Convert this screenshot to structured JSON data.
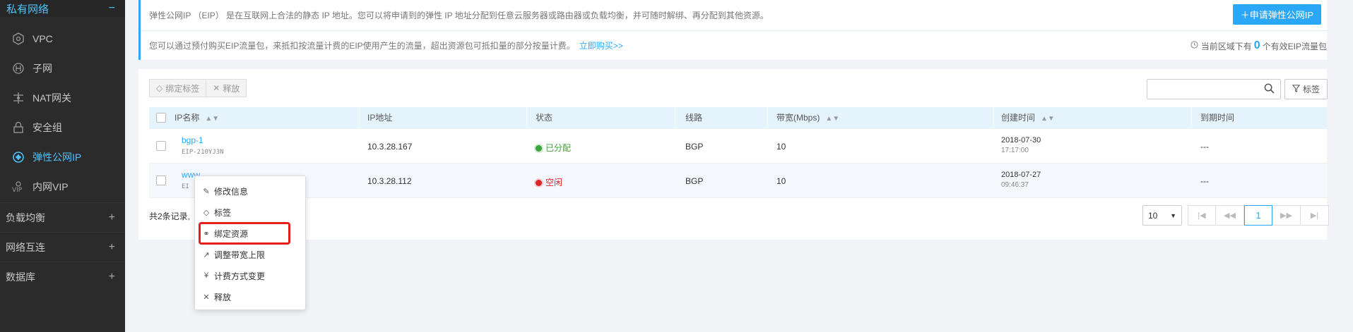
{
  "sidebar": {
    "section_title": "私有网络",
    "section_toggle": "−",
    "items": [
      {
        "label": "VPC",
        "icon": "vpc-icon"
      },
      {
        "label": "子网",
        "icon": "subnet-icon"
      },
      {
        "label": "NAT网关",
        "icon": "nat-gateway-icon"
      },
      {
        "label": "安全组",
        "icon": "lock-icon"
      },
      {
        "label": "弹性公网IP",
        "icon": "eip-icon",
        "active": true
      },
      {
        "label": "内网VIP",
        "icon": "vip-icon"
      }
    ],
    "groups": [
      {
        "label": "负载均衡",
        "toggle": "+"
      },
      {
        "label": "网络互连",
        "toggle": "+"
      },
      {
        "label": "数据库",
        "toggle": "+"
      }
    ]
  },
  "info": {
    "description": "弹性公网IP （EIP） 是在互联网上合法的静态 IP 地址。您可以将申请到的弹性 IP 地址分配到任意云服务器或路由器或负载均衡，并可随时解绑、再分配到其他资源。",
    "traffic_note": "您可以通过预付购买EIP流量包，来抵扣按流量计费的EIP使用产生的流量，超出资源包可抵扣量的部分按量计费。",
    "buy_link": "立即购买>>",
    "apply_button": "＋申请弹性公网IP",
    "quota_prefix": "当前区域下有",
    "quota_count": "0",
    "quota_suffix": "个有效EIP流量包"
  },
  "toolbar": {
    "bind_tag": "绑定标签",
    "release": "释放",
    "search_placeholder": "",
    "tag_filter": "标签"
  },
  "table": {
    "headers": {
      "name": "IP名称",
      "ip": "IP地址",
      "status": "状态",
      "line": "线路",
      "bandwidth": "带宽(Mbps)",
      "created": "创建时间",
      "expire": "到期时间"
    },
    "rows": [
      {
        "name": "bgp-1",
        "id": "EIP-210YJ3N",
        "ip": "10.3.28.167",
        "status": "已分配",
        "status_color": "#3aa43a",
        "line": "BGP",
        "bandwidth": "10",
        "date": "2018-07-30",
        "time": "17:17:00",
        "expire": "---"
      },
      {
        "name": "www",
        "id": "EI",
        "ip": "10.3.28.112",
        "status": "空闲",
        "status_color": "#e0242b",
        "line": "BGP",
        "bandwidth": "10",
        "date": "2018-07-27",
        "time": "09:46:37",
        "expire": "---"
      }
    ]
  },
  "footer": {
    "total_text": "共2条记录,",
    "page_size": "10",
    "current_page": "1"
  },
  "context_menu": {
    "items": [
      {
        "label": "修改信息",
        "icon": "edit-icon",
        "glyph": "✎"
      },
      {
        "label": "标签",
        "icon": "tag-icon",
        "glyph": "◇"
      },
      {
        "label": "绑定资源",
        "icon": "link-icon",
        "glyph": "⚭"
      },
      {
        "label": "调整带宽上限",
        "icon": "trend-icon",
        "glyph": "↗"
      },
      {
        "label": "计费方式变更",
        "icon": "yen-icon",
        "glyph": "¥"
      },
      {
        "label": "释放",
        "icon": "close-icon",
        "glyph": "✕"
      }
    ],
    "highlighted_index": 2
  },
  "colors": {
    "accent": "#2aa8f7",
    "highlight": "#e61e1e",
    "sidebar_bg": "#2b2b2b"
  }
}
